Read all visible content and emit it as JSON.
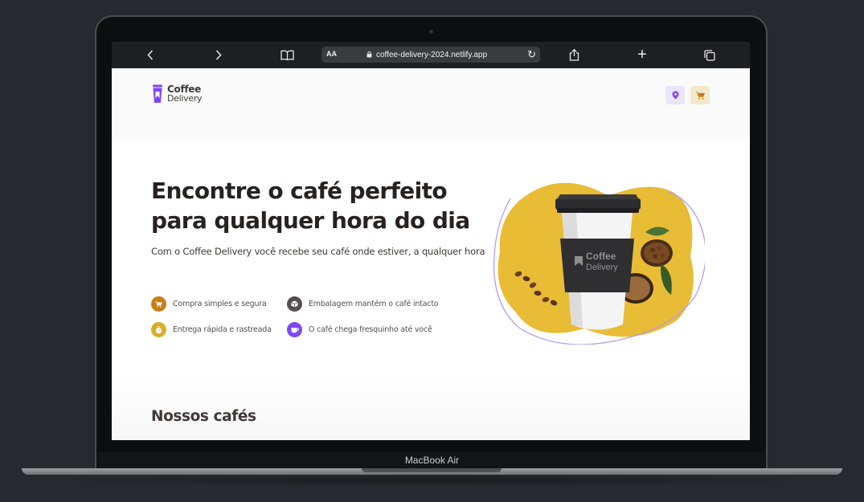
{
  "device": {
    "label": "MacBook Air"
  },
  "browser": {
    "url": "coffee-delivery-2024.netlify.app",
    "text_size_label": "AA",
    "icons": {
      "back": "chevron-left-icon",
      "forward": "chevron-right-icon",
      "bookmarks": "book-icon",
      "lock": "lock-icon",
      "reload": "reload-icon",
      "share": "share-icon",
      "new_tab": "plus-icon",
      "tabs": "tabs-icon"
    }
  },
  "header": {
    "logo_line1": "Coffee",
    "logo_line2": "Delivery",
    "location_icon": "map-pin-icon",
    "cart_icon": "shopping-cart-icon"
  },
  "hero": {
    "title": "Encontre o café perfeito para qualquer hora do dia",
    "subtitle": "Com o Coffee Delivery você recebe seu café onde estiver, a qualquer hora",
    "features": [
      {
        "label": "Compra simples e segura",
        "icon": "shopping-cart-icon",
        "color": "#c47f17"
      },
      {
        "label": "Embalagem mantém o café intacto",
        "icon": "package-icon",
        "color": "#574f4d"
      },
      {
        "label": "Entrega rápida e rastreada",
        "icon": "timer-icon",
        "color": "#dbac2c"
      },
      {
        "label": "O café chega fresquinho até você",
        "icon": "coffee-icon",
        "color": "#8047f8"
      }
    ],
    "image": {
      "cup_brand_line1": "Coffee",
      "cup_brand_line2": "Delivery"
    }
  },
  "section": {
    "title": "Nossos cafés"
  },
  "colors": {
    "brand_purple": "#8047f8",
    "yellow": "#dbac2c",
    "yellow_dark": "#c47f17",
    "dark_text": "#272221"
  }
}
